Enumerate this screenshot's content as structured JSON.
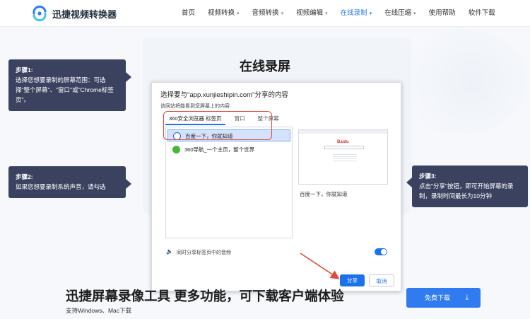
{
  "brand": {
    "name": "迅捷视频转换器"
  },
  "nav": {
    "items": [
      {
        "label": "首页",
        "caret": ""
      },
      {
        "label": "视频转换",
        "caret": "▾"
      },
      {
        "label": "音频转换",
        "caret": "▾"
      },
      {
        "label": "视频编辑",
        "caret": "▾"
      },
      {
        "label": "在线录制",
        "caret": "▾"
      },
      {
        "label": "在线压缩",
        "caret": "▾"
      },
      {
        "label": "使用帮助",
        "caret": ""
      },
      {
        "label": "软件下载",
        "caret": ""
      }
    ],
    "active_index": 4
  },
  "hero": {
    "title": "在线录屏"
  },
  "steps": [
    {
      "step": "步骤1:",
      "text": "选择您想要录制的屏幕范围：可选择\"整个屏幕\"、\"窗口\"或\"Chrome标签页\"。"
    },
    {
      "step": "步骤2:",
      "text": "如果您想要录制系统声音，请勾选"
    },
    {
      "step": "步骤3:",
      "text": "点击\"分享\"按钮，即可开始屏幕的录制，录制时间最长为10分钟"
    }
  ],
  "dialog": {
    "title": "选择要与\"app.xunjieshipin.com\"分享的内容",
    "subtitle": "该网站将能看到您屏幕上的内容",
    "tabs": [
      "360安全浏览器 标签页",
      "窗口",
      "整个屏幕"
    ],
    "list": [
      {
        "label": "百度一下，你就知道",
        "icon": "baidu-paw-icon",
        "selected": true
      },
      {
        "label": "360导航_一个主页，整个世界",
        "icon": "360-globe-icon",
        "selected": false
      }
    ],
    "preview": {
      "logo_text": "Baidu",
      "caption": "百度一下，你就知道"
    },
    "audio_label": "同时分享标签页中的音频",
    "share_label": "分享",
    "cancel_label": "取消"
  },
  "promo": {
    "title": "迅捷屏幕录像工具 更多功能，可下载客户端体验",
    "subtitle": "支持Windows、Mac下载",
    "download_label": "免费下载"
  },
  "colors": {
    "accent": "#2f7bef",
    "callout": "#3b4260",
    "highlight": "#e34a3b"
  }
}
